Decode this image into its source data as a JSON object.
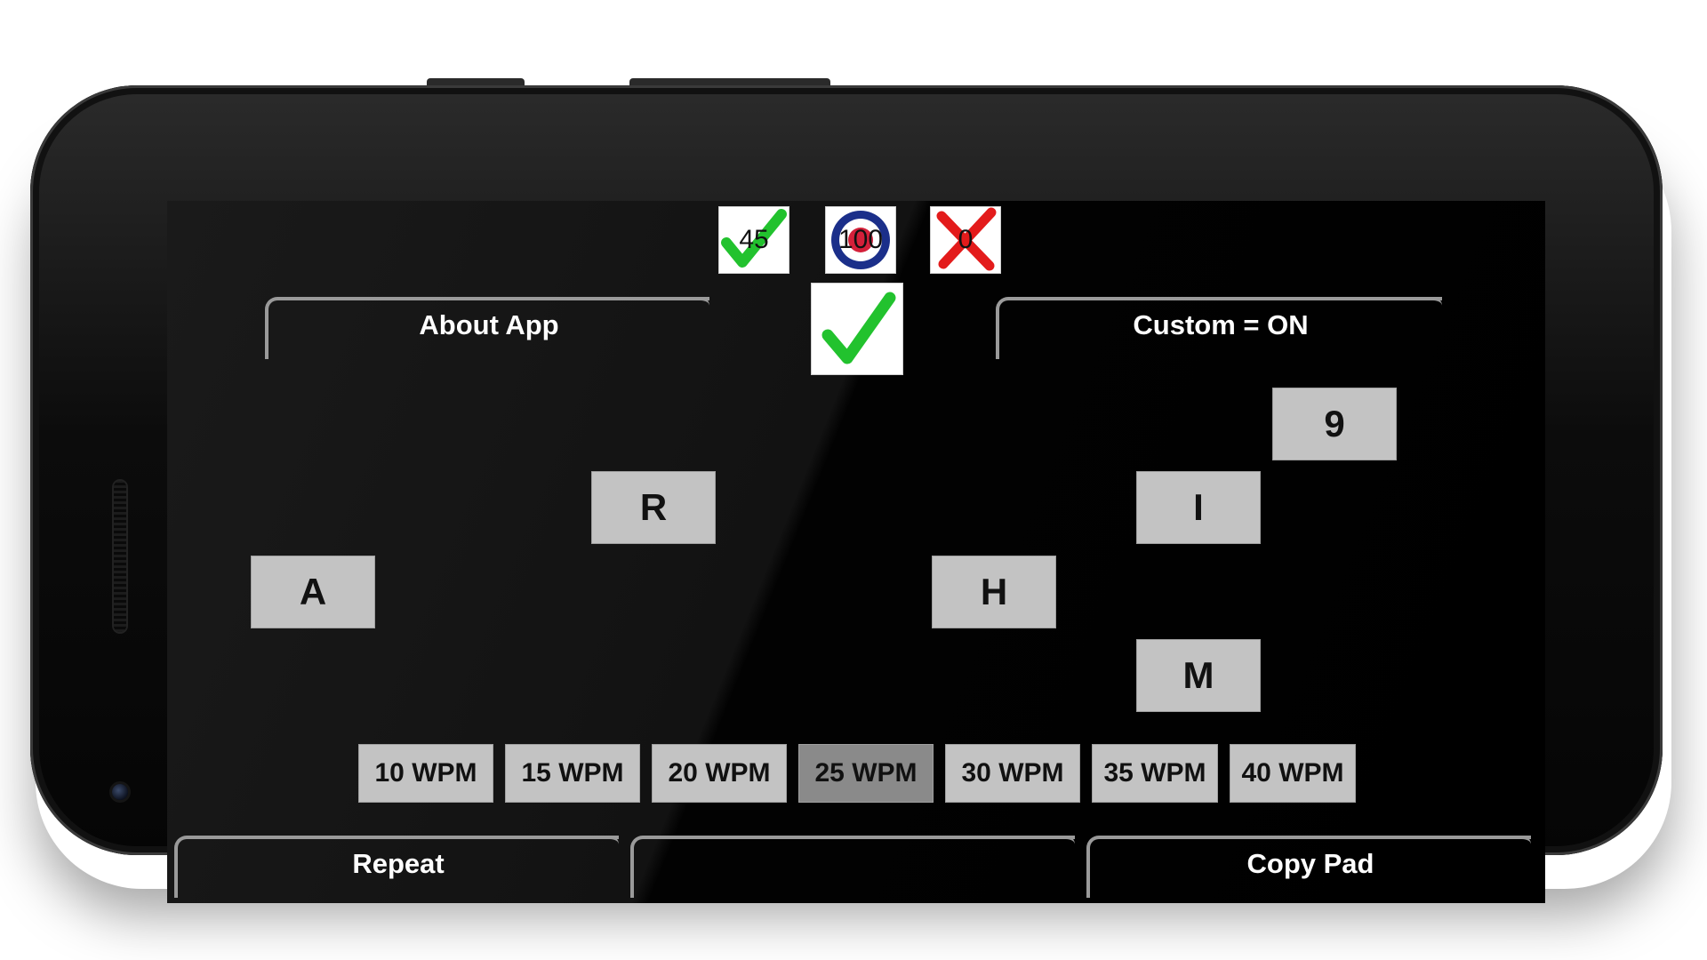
{
  "score": {
    "correct": "45",
    "target": "100",
    "wrong": "0"
  },
  "top_buttons": {
    "about": "About App",
    "custom": "Custom = ON"
  },
  "letters": [
    {
      "id": "9",
      "label": "9"
    },
    {
      "id": "R",
      "label": "R"
    },
    {
      "id": "I",
      "label": "I"
    },
    {
      "id": "A",
      "label": "A"
    },
    {
      "id": "H",
      "label": "H"
    },
    {
      "id": "M",
      "label": "M"
    }
  ],
  "wpm": {
    "options": [
      "10 WPM",
      "15 WPM",
      "20 WPM",
      "25 WPM",
      "30 WPM",
      "35 WPM",
      "40 WPM"
    ],
    "selected": "25 WPM"
  },
  "bottom_buttons": {
    "repeat": "Repeat",
    "middle": "",
    "copy_pad": "Copy Pad"
  },
  "colors": {
    "check_green": "#22c22e",
    "cross_red": "#e31b1b",
    "target_blue": "#1b2f8a",
    "target_red": "#d4203a",
    "key_gray": "#c3c3c3",
    "key_selected": "#8a8a8a"
  }
}
